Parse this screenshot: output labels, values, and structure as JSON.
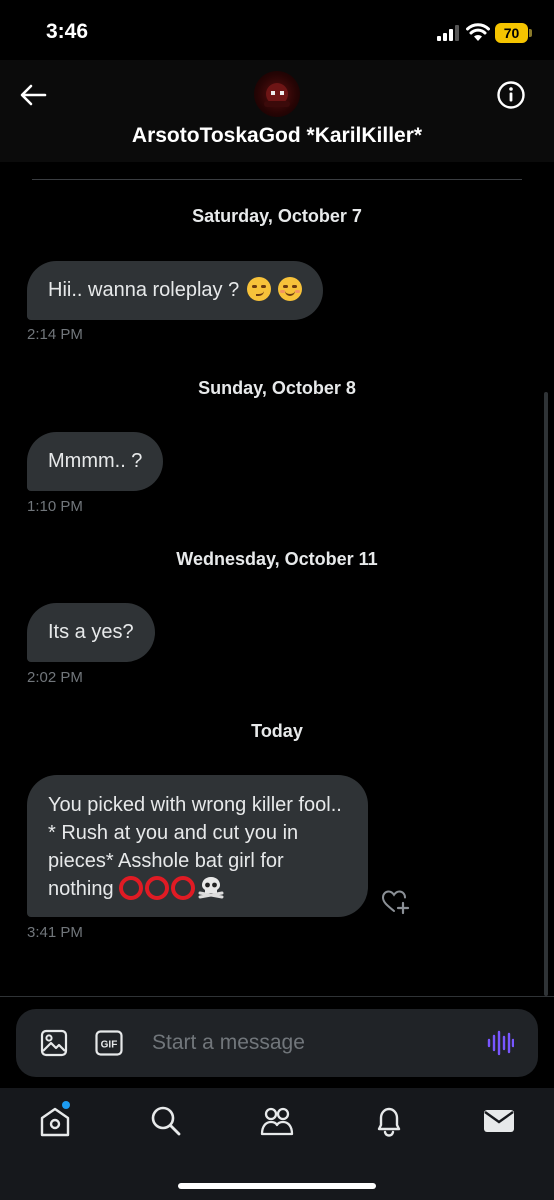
{
  "status_bar": {
    "time": "3:46",
    "battery": "70"
  },
  "header": {
    "contact_name": "ArsotoToskaGod *KarilKiller*"
  },
  "messages": [
    {
      "date": "Saturday, October 7",
      "text": "Hii.. wanna roleplay ? ",
      "time": "2:14 PM",
      "emoji": [
        "smirking-face-emoji",
        "smiling-face-emoji"
      ]
    },
    {
      "date": "Sunday, October 8",
      "text": "Mmmm.. ?",
      "time": "1:10 PM"
    },
    {
      "date": "Wednesday, October 11",
      "text": "Its a yes?",
      "time": "2:02 PM"
    },
    {
      "date": "Today",
      "text": "You picked with wrong killer fool.. * Rush at you and cut you in pieces* Asshole bat girl for nothing ",
      "time": "3:41 PM",
      "emoji": [
        "red-circle-emoji",
        "red-circle-emoji",
        "red-circle-emoji",
        "skull-crossbones-emoji"
      ]
    }
  ],
  "composer": {
    "placeholder": "Start a message",
    "accent_color": "#7856ff"
  },
  "nav": [
    "home-icon",
    "search-icon",
    "communities-icon",
    "notifications-icon",
    "messages-icon"
  ]
}
